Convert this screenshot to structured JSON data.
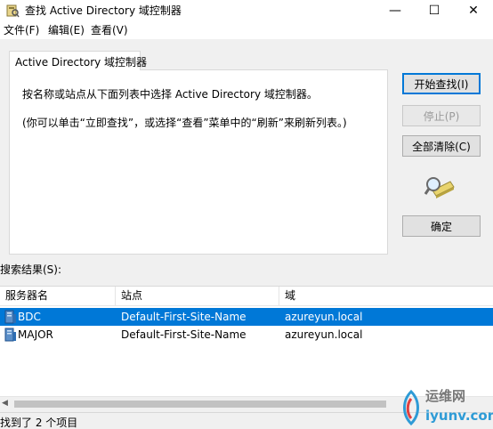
{
  "window": {
    "title": "查找 Active Directory 域控制器",
    "controls": {
      "minimize": "—",
      "maximize": "☐",
      "close": "✕"
    }
  },
  "menu": [
    {
      "label": "文件(F)"
    },
    {
      "label": "编辑(E)"
    },
    {
      "label": "查看(V)"
    }
  ],
  "tab": {
    "label": "Active Directory 域控制器",
    "description_line1": "按名称或站点从下面列表中选择 Active Directory 域控制器。",
    "description_line2": "(你可以单击“立即查找”，或选择“查看”菜单中的“刷新”来刷新列表。)"
  },
  "buttons": {
    "start": "开始查找(I)",
    "stop": "停止(P)",
    "clear": "全部清除(C)",
    "ok": "确定"
  },
  "results": {
    "label": "搜索结果(S):",
    "columns": [
      "服务器名",
      "站点",
      "域"
    ],
    "rows": [
      {
        "server": "BDC",
        "site": "Default-First-Site-Name",
        "domain": "azureyun.local",
        "selected": true
      },
      {
        "server": "MAJOR",
        "site": "Default-First-Site-Name",
        "domain": "azureyun.local",
        "selected": false
      }
    ]
  },
  "status": "找到了 2 个项目",
  "watermark": {
    "top": "运维网",
    "bottom": "iyunv.com"
  },
  "colors": {
    "selection": "#0078d7",
    "default_button_border": "#0078d7"
  }
}
